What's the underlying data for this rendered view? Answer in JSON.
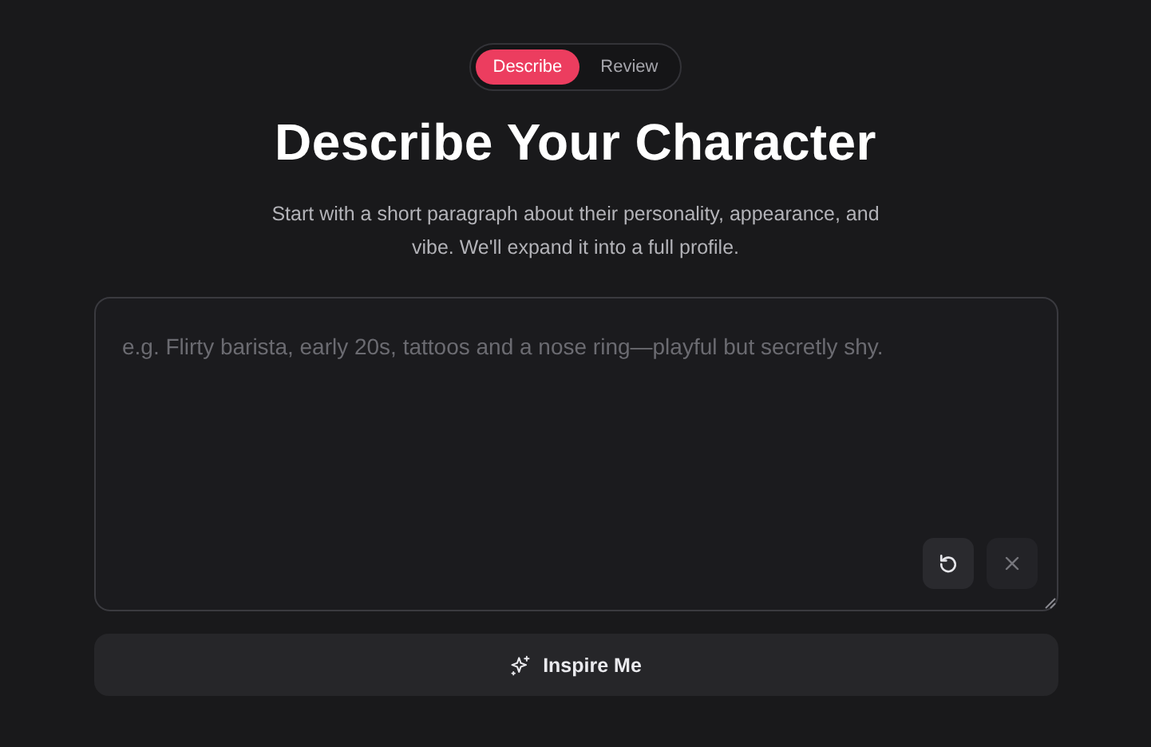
{
  "tabs": [
    {
      "label": "Describe",
      "selected": true
    },
    {
      "label": "Review",
      "selected": false
    }
  ],
  "heading": "Describe Your Character",
  "subtitle": "Start with a short paragraph about their personality, appearance, and vibe. We'll expand it into a full profile.",
  "description": {
    "placeholder": "e.g. Flirty barista, early 20s, tattoos and a nose ring—playful but secretly shy."
  },
  "actions": [
    {
      "kind": "reset",
      "disabled": false
    },
    {
      "kind": "clear",
      "disabled": true
    }
  ],
  "inspire_button": {
    "label": "Inspire Me"
  }
}
